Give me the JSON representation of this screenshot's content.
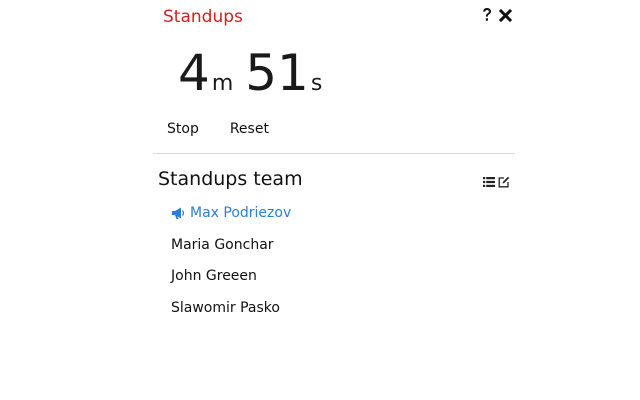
{
  "app": {
    "title": "Standups"
  },
  "header": {
    "help_icon": "question-mark-icon",
    "close_icon": "close-icon"
  },
  "timer": {
    "minutes": "4",
    "minutes_unit": "m",
    "seconds": "51",
    "seconds_unit": "s"
  },
  "controls": {
    "stop_label": "Stop",
    "reset_label": "Reset"
  },
  "team": {
    "title": "Standups team",
    "list_icon": "list-icon",
    "edit_icon": "edit-icon",
    "current_speaker_icon": "megaphone-icon",
    "members": [
      {
        "name": "Max Podriezov",
        "active": true
      },
      {
        "name": "Maria Gonchar",
        "active": false
      },
      {
        "name": "John Greeen",
        "active": false
      },
      {
        "name": "Slawomir Pasko",
        "active": false
      }
    ]
  },
  "colors": {
    "title": "#d21f1f",
    "active_member": "#2b7fd9",
    "divider": "#d9d9d9"
  }
}
